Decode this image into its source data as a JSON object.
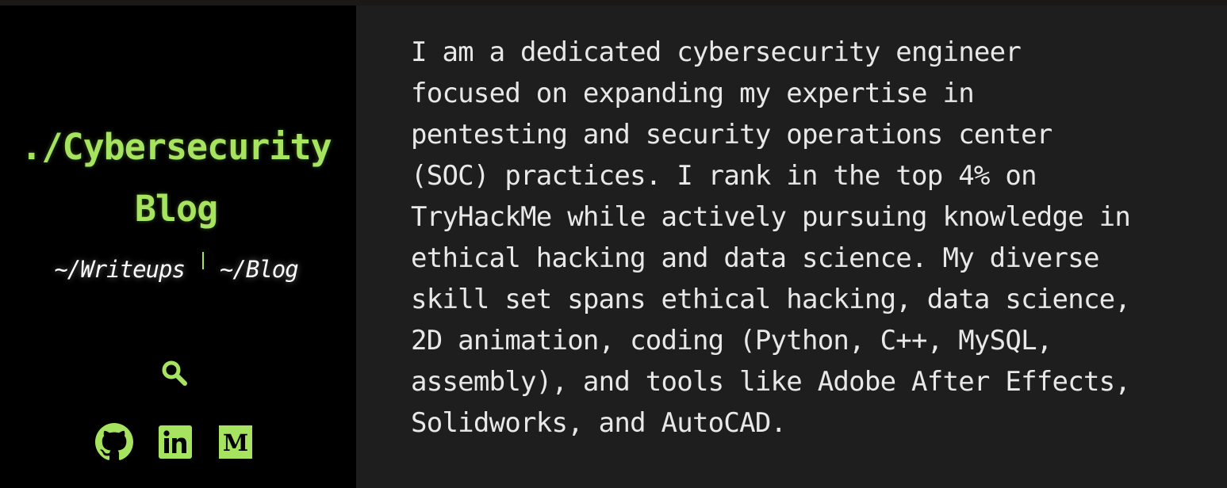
{
  "colors": {
    "accent": "#a6e35f",
    "sidebar_bg": "#000000",
    "main_bg": "#1e1e1e",
    "text": "#e8e8e8"
  },
  "sidebar": {
    "title_line1": "./Cybersecurity",
    "title_line2": "Blog",
    "nav": [
      {
        "label": "~/Writeups"
      },
      {
        "label": "~/Blog"
      }
    ],
    "search_icon": "search-icon",
    "socials": [
      {
        "name": "github-icon"
      },
      {
        "name": "linkedin-icon"
      },
      {
        "name": "medium-icon"
      }
    ]
  },
  "main": {
    "about_text": "I am a dedicated cybersecurity engineer\nfocused on expanding my expertise in\npentesting and security operations center\n(SOC) practices. I rank in the top 4% on\nTryHackMe while actively pursuing knowledge in\nethical hacking and data science. My diverse\nskill set spans ethical hacking, data science,\n2D animation, coding (Python, C++, MySQL,\nassembly), and tools like Adobe After Effects,\nSolidworks, and AutoCAD."
  }
}
